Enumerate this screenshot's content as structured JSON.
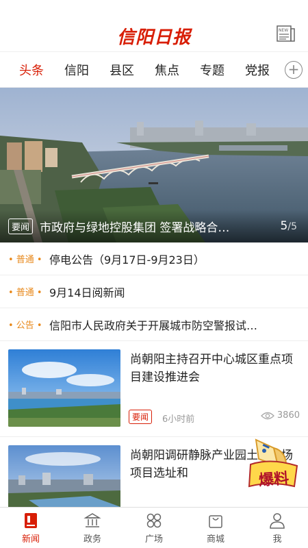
{
  "header": {
    "logo_text": "信阳日报",
    "news_icon": "newspaper-icon"
  },
  "tabs": [
    {
      "label": "头条",
      "active": true
    },
    {
      "label": "信阳"
    },
    {
      "label": "县区"
    },
    {
      "label": "焦点"
    },
    {
      "label": "专题"
    },
    {
      "label": "党报"
    }
  ],
  "tabs_more_icon": "plus-circle-icon",
  "banner": {
    "tag": "要闻",
    "title": "市政府与绿地控股集团 签署战略合…",
    "current": "5",
    "total": "/5"
  },
  "notices": [
    {
      "tag": "• 普通 •",
      "text": "停电公告（9月17日-9月23日）"
    },
    {
      "tag": "• 普通 •",
      "text": "9月14日阅新闻"
    },
    {
      "tag": "• 公告 •",
      "text": "信阳市人民政府关于开展城市防空警报试…"
    }
  ],
  "articles": [
    {
      "title": "尚朝阳主持召开中心城区重点项目建设推进会",
      "tag": "要闻",
      "time": "6小时前",
      "views": "3860"
    },
    {
      "title": "尚朝阳调研静脉产业园土消纳场项目选址和"
    }
  ],
  "floating_badge": {
    "label": "爆料"
  },
  "bottom_nav": [
    {
      "label": "新闻",
      "icon": "news-icon",
      "active": true
    },
    {
      "label": "政务",
      "icon": "government-icon"
    },
    {
      "label": "广场",
      "icon": "square-icon"
    },
    {
      "label": "商城",
      "icon": "shop-bag-icon"
    },
    {
      "label": "我",
      "icon": "user-icon"
    }
  ],
  "colors": {
    "accent": "#d81e06",
    "notice_tag": "#e8891c"
  }
}
